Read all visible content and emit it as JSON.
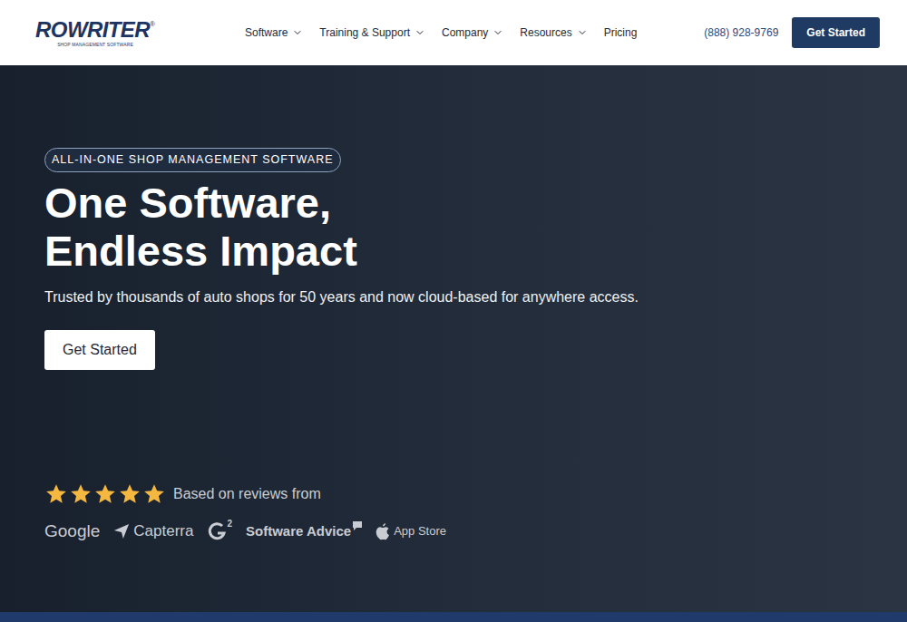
{
  "header": {
    "logo": {
      "text": "ROWRITER",
      "mark": "®",
      "tagline": "SHOP MANAGEMENT SOFTWARE"
    },
    "nav": [
      {
        "label": "Software",
        "dropdown": true
      },
      {
        "label": "Training & Support",
        "dropdown": true
      },
      {
        "label": "Company",
        "dropdown": true
      },
      {
        "label": "Resources",
        "dropdown": true
      },
      {
        "label": "Pricing",
        "dropdown": false
      }
    ],
    "phone": "(888) 928-9769",
    "cta": "Get Started"
  },
  "hero": {
    "badge": "ALL-IN-ONE SHOP MANAGEMENT SOFTWARE",
    "heading": [
      "One Software,",
      "Endless Impact"
    ],
    "subtitle": "Trusted by thousands of auto shops for 50 years and now cloud-based for anywhere access.",
    "button": "Get Started",
    "rating": {
      "stars": 5,
      "text": "Based on reviews from"
    },
    "sources": [
      {
        "label": "Google",
        "kind": "plain"
      },
      {
        "label": "Capterra",
        "kind": "capterra"
      },
      {
        "label": "2",
        "kind": "g2"
      },
      {
        "label": "Software Advice",
        "kind": "softwareadvice"
      },
      {
        "label": "App Store",
        "kind": "apple"
      }
    ]
  }
}
